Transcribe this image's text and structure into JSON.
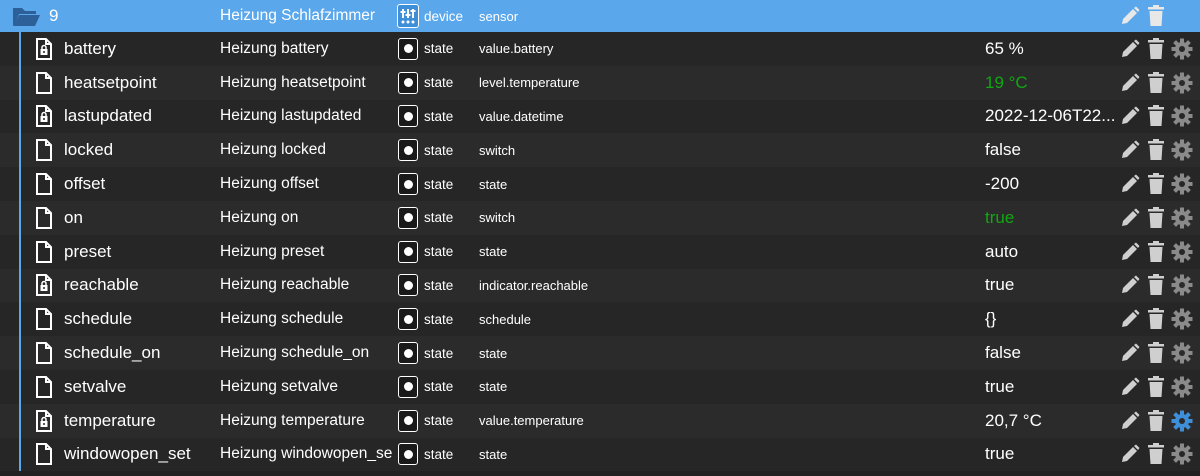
{
  "device": {
    "name": "9",
    "description": "Heizung Schlafzimmer",
    "type": "device",
    "role": "sensor"
  },
  "states": [
    {
      "name": "battery",
      "description": "Heizung battery",
      "type": "state",
      "role": "value.battery",
      "value": "65 %",
      "value_color": "#ffffff",
      "file_icon": "file-lock-icon",
      "gear_color": "#8a8a8a"
    },
    {
      "name": "heatsetpoint",
      "description": "Heizung heatsetpoint",
      "type": "state",
      "role": "level.temperature",
      "value": "19 °C",
      "value_color": "#10a810",
      "file_icon": "file-icon",
      "gear_color": "#8a8a8a"
    },
    {
      "name": "lastupdated",
      "description": "Heizung lastupdated",
      "type": "state",
      "role": "value.datetime",
      "value": "2022-12-06T22...",
      "value_color": "#ffffff",
      "file_icon": "file-lock-icon",
      "gear_color": "#8a8a8a"
    },
    {
      "name": "locked",
      "description": "Heizung locked",
      "type": "state",
      "role": "switch",
      "value": "false",
      "value_color": "#ffffff",
      "file_icon": "file-icon",
      "gear_color": "#8a8a8a"
    },
    {
      "name": "offset",
      "description": "Heizung offset",
      "type": "state",
      "role": "state",
      "value": "-200",
      "value_color": "#ffffff",
      "file_icon": "file-icon",
      "gear_color": "#8a8a8a"
    },
    {
      "name": "on",
      "description": "Heizung on",
      "type": "state",
      "role": "switch",
      "value": "true",
      "value_color": "#10a810",
      "file_icon": "file-icon",
      "gear_color": "#8a8a8a"
    },
    {
      "name": "preset",
      "description": "Heizung preset",
      "type": "state",
      "role": "state",
      "value": "auto",
      "value_color": "#ffffff",
      "file_icon": "file-icon",
      "gear_color": "#8a8a8a"
    },
    {
      "name": "reachable",
      "description": "Heizung reachable",
      "type": "state",
      "role": "indicator.reachable",
      "value": "true",
      "value_color": "#ffffff",
      "file_icon": "file-lock-icon",
      "gear_color": "#8a8a8a"
    },
    {
      "name": "schedule",
      "description": "Heizung schedule",
      "type": "state",
      "role": "schedule",
      "value": "{}",
      "value_color": "#ffffff",
      "file_icon": "file-icon",
      "gear_color": "#8a8a8a"
    },
    {
      "name": "schedule_on",
      "description": "Heizung schedule_on",
      "type": "state",
      "role": "state",
      "value": "false",
      "value_color": "#ffffff",
      "file_icon": "file-icon",
      "gear_color": "#8a8a8a"
    },
    {
      "name": "setvalve",
      "description": "Heizung setvalve",
      "type": "state",
      "role": "state",
      "value": "true",
      "value_color": "#ffffff",
      "file_icon": "file-icon",
      "gear_color": "#8a8a8a"
    },
    {
      "name": "temperature",
      "description": "Heizung temperature",
      "type": "state",
      "role": "value.temperature",
      "value": "20,7 °C",
      "value_color": "#ffffff",
      "file_icon": "file-lock-icon",
      "gear_color": "#3f8fd8"
    },
    {
      "name": "windowopen_set",
      "description": "Heizung windowopen_set",
      "type": "state",
      "role": "state",
      "value": "true",
      "value_color": "#ffffff",
      "file_icon": "file-icon",
      "gear_color": "#8a8a8a"
    }
  ],
  "colors": {
    "accent": "#5aa7ec",
    "background": "#212121",
    "value_true_green": "#10a810",
    "action_icon": "#cfcfcf",
    "gear_default": "#8a8a8a",
    "gear_active": "#3f8fd8"
  }
}
